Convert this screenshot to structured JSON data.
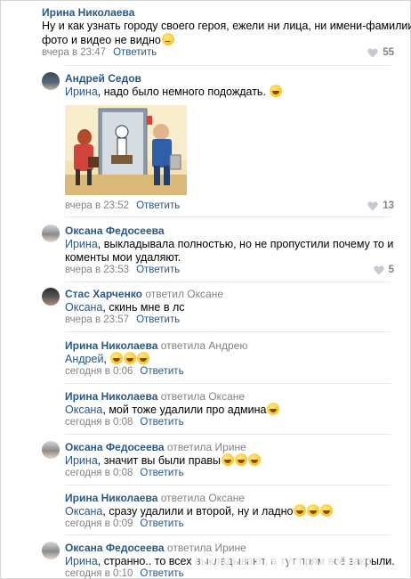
{
  "comments": [
    {
      "author": "Ирина Николаева",
      "reply_to": "",
      "lines": [
        "Ну и как узнать городу своего героя, ежели ни лица, ни имени-фамилии на",
        "фото и видео не видно"
      ],
      "time": "вчера в 23:47",
      "reply_label": "Ответить",
      "likes": "55"
    },
    {
      "author": "Андрей Седов",
      "reply_to": "",
      "addressee": "Ирина",
      "lines": [
        ", надо было немного подождать."
      ],
      "time": "вчера в 23:52",
      "reply_label": "Ответить",
      "likes": "13"
    },
    {
      "author": "Оксана Федосеева",
      "reply_to": "",
      "addressee": "Ирина",
      "lines": [
        ", выкладывала полностью, но не пропустили почему то и",
        "коменты мои удаляют."
      ],
      "time": "вчера в 23:53",
      "reply_label": "Ответить",
      "likes": "5"
    },
    {
      "author": "Стас Харченко",
      "reply_to": "ответил Оксане",
      "addressee": "Оксана",
      "lines": [
        ", скинь мне в лс"
      ],
      "time": "вчера в 23:57",
      "reply_label": "Ответить"
    },
    {
      "author": "Ирина Николаева",
      "reply_to": "ответила Андрею",
      "addressee": "Андрей",
      "lines": [
        ","
      ],
      "time": "сегодня в 0:06",
      "reply_label": "Ответить"
    },
    {
      "author": "Ирина Николаева",
      "reply_to": "ответила Оксане",
      "addressee": "Оксана",
      "lines": [
        ", мой тоже удалили про админа"
      ],
      "time": "сегодня в 0:08",
      "reply_label": "Ответить"
    },
    {
      "author": "Оксана Федосеева",
      "reply_to": "ответила Ирине",
      "addressee": "Ирина",
      "lines": [
        ", значит вы были правы"
      ],
      "time": "сегодня в 0:08",
      "reply_label": "Ответить"
    },
    {
      "author": "Ирина Николаева",
      "reply_to": "ответила Оксане",
      "addressee": "Оксана",
      "lines": [
        ", сразу удалили и второй, ну и ладно"
      ],
      "time": "сегодня в 0:09",
      "reply_label": "Ответить"
    },
    {
      "author": "Оксана Федосеева",
      "reply_to": "ответила Ирине",
      "addressee": "Ирина",
      "lines": [
        ", странно.. то всех выкладывают, а тут прям всё закрыли."
      ],
      "time": "сегодня в 0:10",
      "reply_label": "Ответить"
    }
  ],
  "colors": {
    "link": "#2a5885",
    "meta": "#828282",
    "divider": "#e7e8ec"
  },
  "icons": [
    "heart-icon",
    "emoji-icon",
    "avatar"
  ]
}
